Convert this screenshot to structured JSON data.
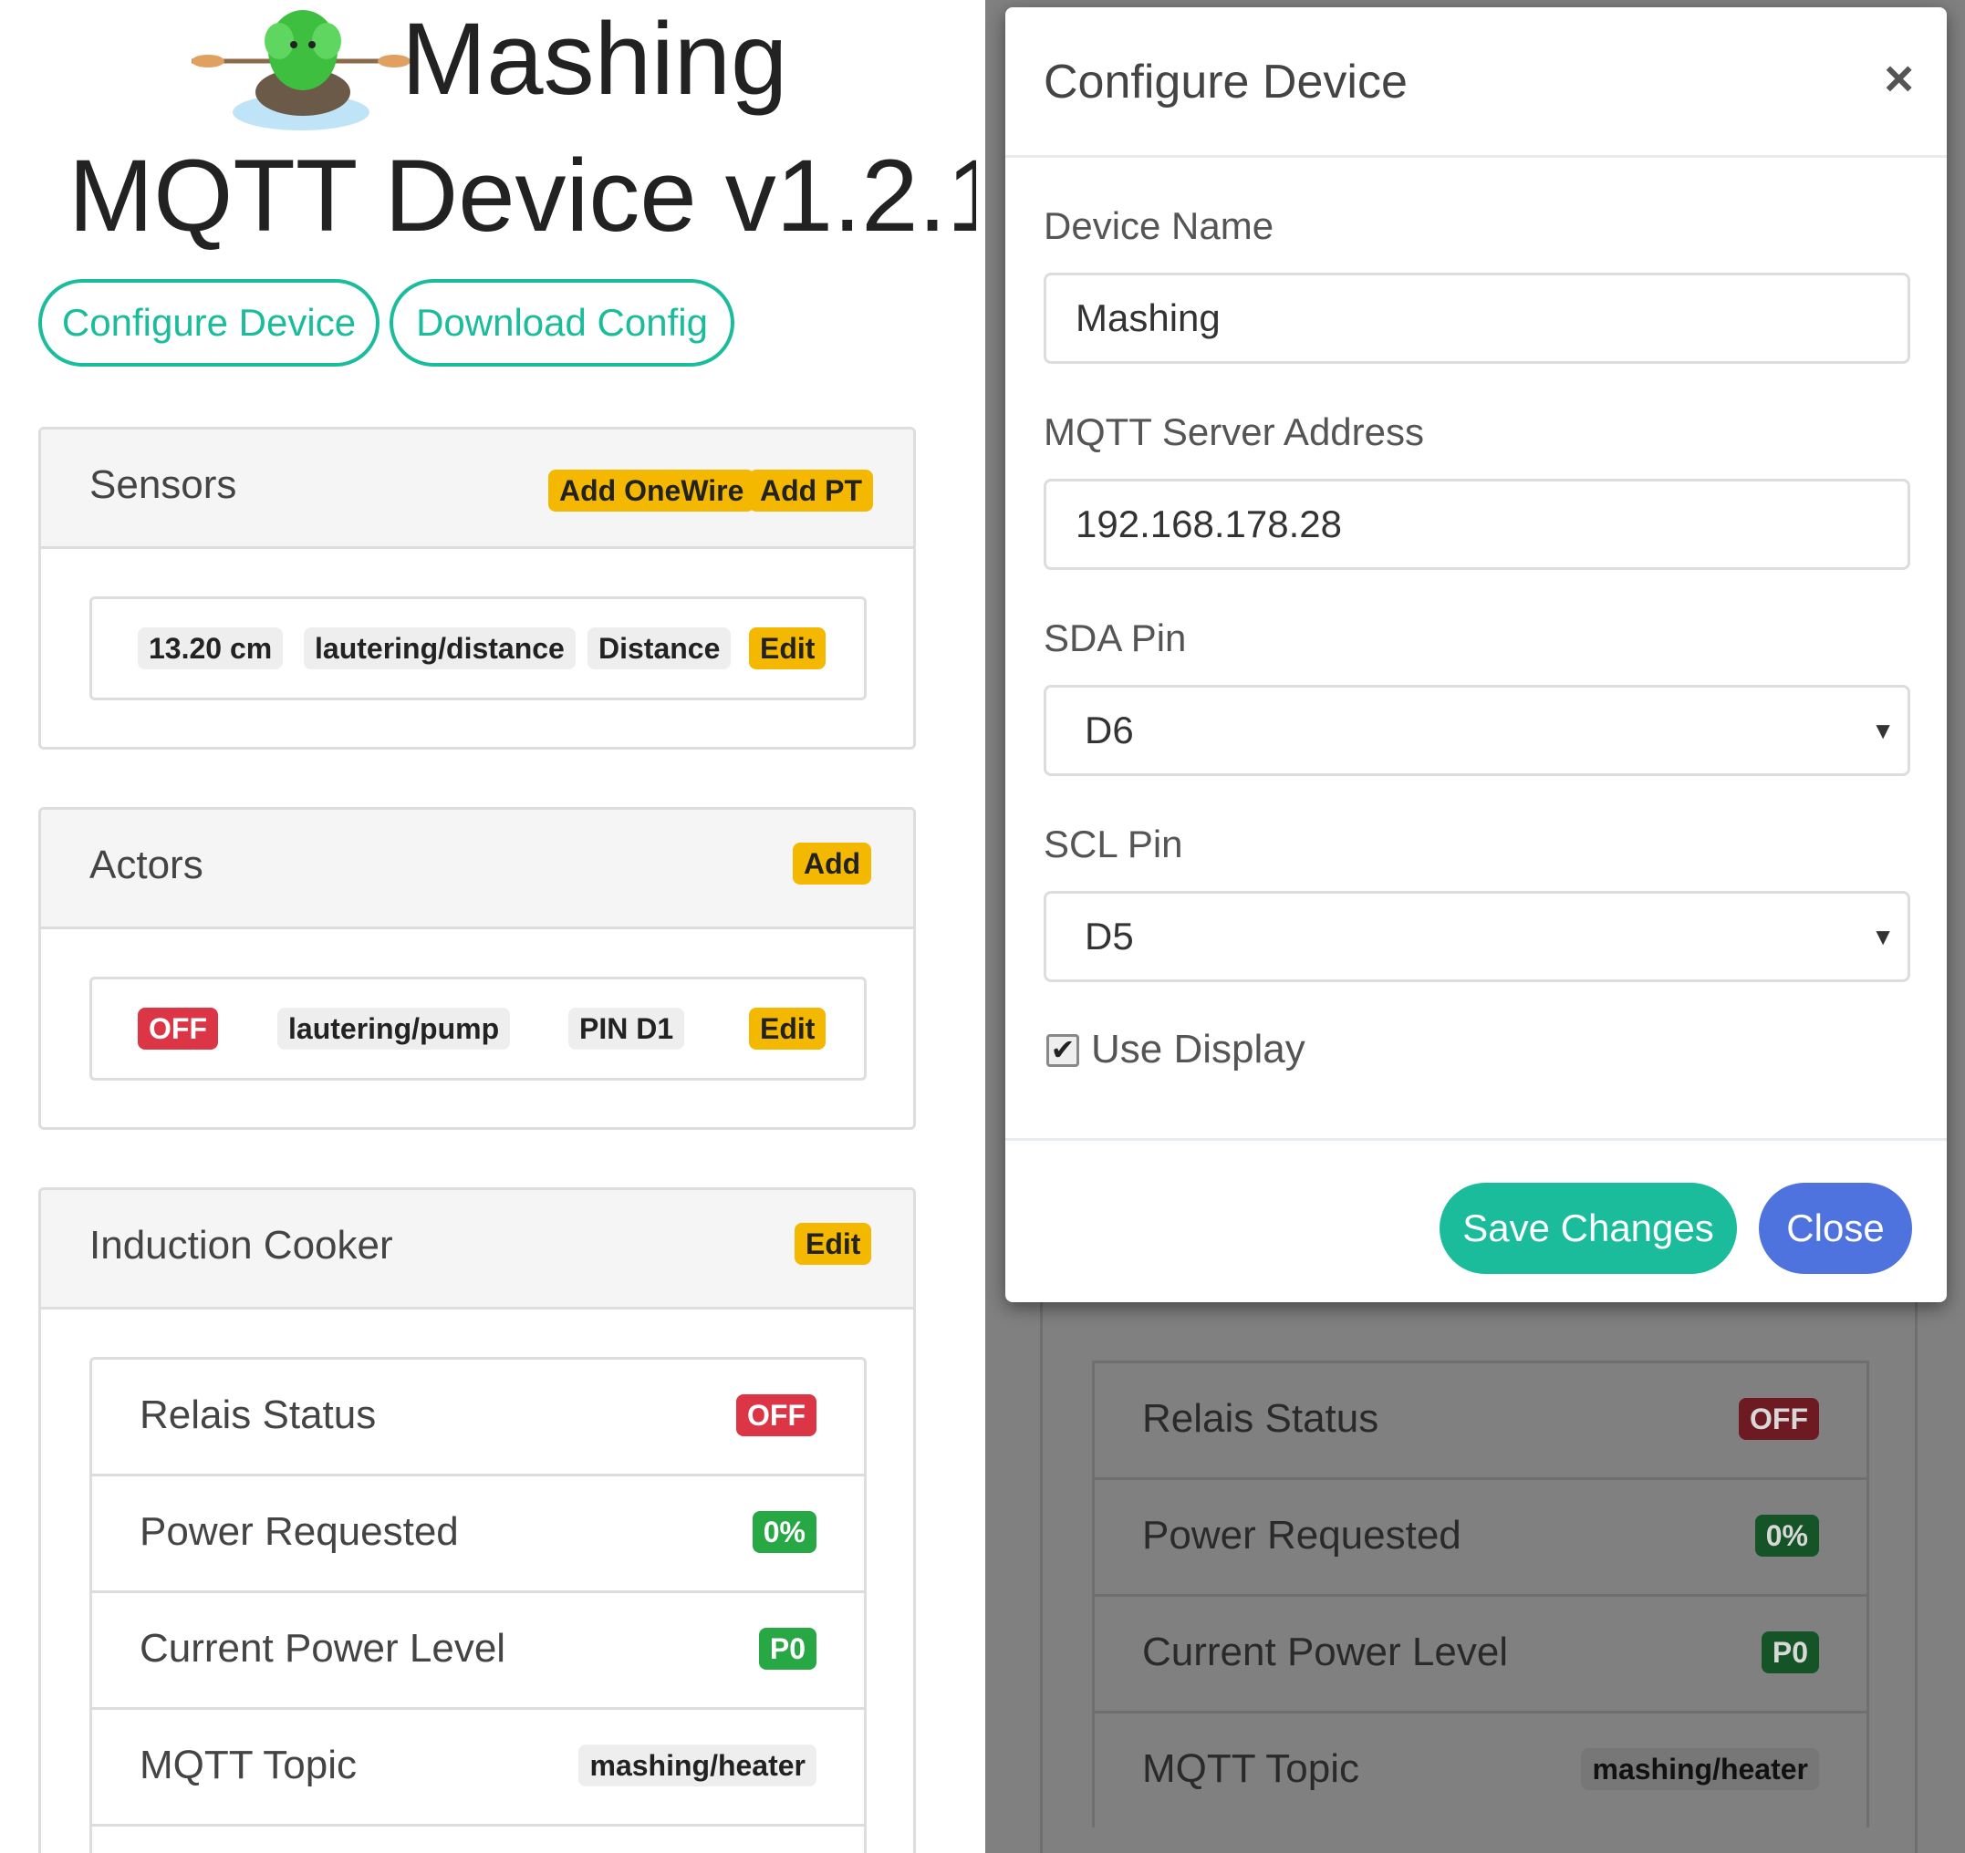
{
  "header": {
    "title_line1": "Mashing",
    "title_line2": "MQTT Device v1.2.1",
    "logo_icon": "hop-kayak-logo"
  },
  "actions": {
    "configure_label": "Configure Device",
    "download_label": "Download Config"
  },
  "sensors": {
    "title": "Sensors",
    "add_onewire_label": "Add OneWire",
    "add_pt_label": "Add PT",
    "items": [
      {
        "value": "13.20 cm",
        "topic": "lautering/distance",
        "name": "Distance",
        "edit_label": "Edit"
      }
    ]
  },
  "actors": {
    "title": "Actors",
    "add_label": "Add",
    "items": [
      {
        "state": "OFF",
        "topic": "lautering/pump",
        "pin": "PIN D1",
        "edit_label": "Edit"
      }
    ]
  },
  "induction": {
    "title": "Induction Cooker",
    "edit_label": "Edit",
    "rows": [
      {
        "label": "Relais Status",
        "value": "OFF"
      },
      {
        "label": "Power Requested",
        "value": "0%"
      },
      {
        "label": "Current Power Level",
        "value": "P0"
      },
      {
        "label": "MQTT Topic",
        "value": "mashing/heater"
      }
    ]
  },
  "modal": {
    "title": "Configure Device",
    "close_icon": "close-icon",
    "device_name_label": "Device Name",
    "device_name_value": "Mashing",
    "mqtt_label": "MQTT Server Address",
    "mqtt_value": "192.168.178.28",
    "sda_label": "SDA Pin",
    "sda_value": "D6",
    "scl_label": "SCL Pin",
    "scl_value": "D5",
    "use_display_label": "Use Display",
    "use_display_checked": true,
    "save_label": "Save Changes",
    "close_label": "Close"
  },
  "colors": {
    "accent": "#1abc9c",
    "warning": "#f5b800",
    "danger": "#dc3545",
    "success": "#28a745",
    "primary": "#4e73df",
    "overlay": "#808080"
  }
}
